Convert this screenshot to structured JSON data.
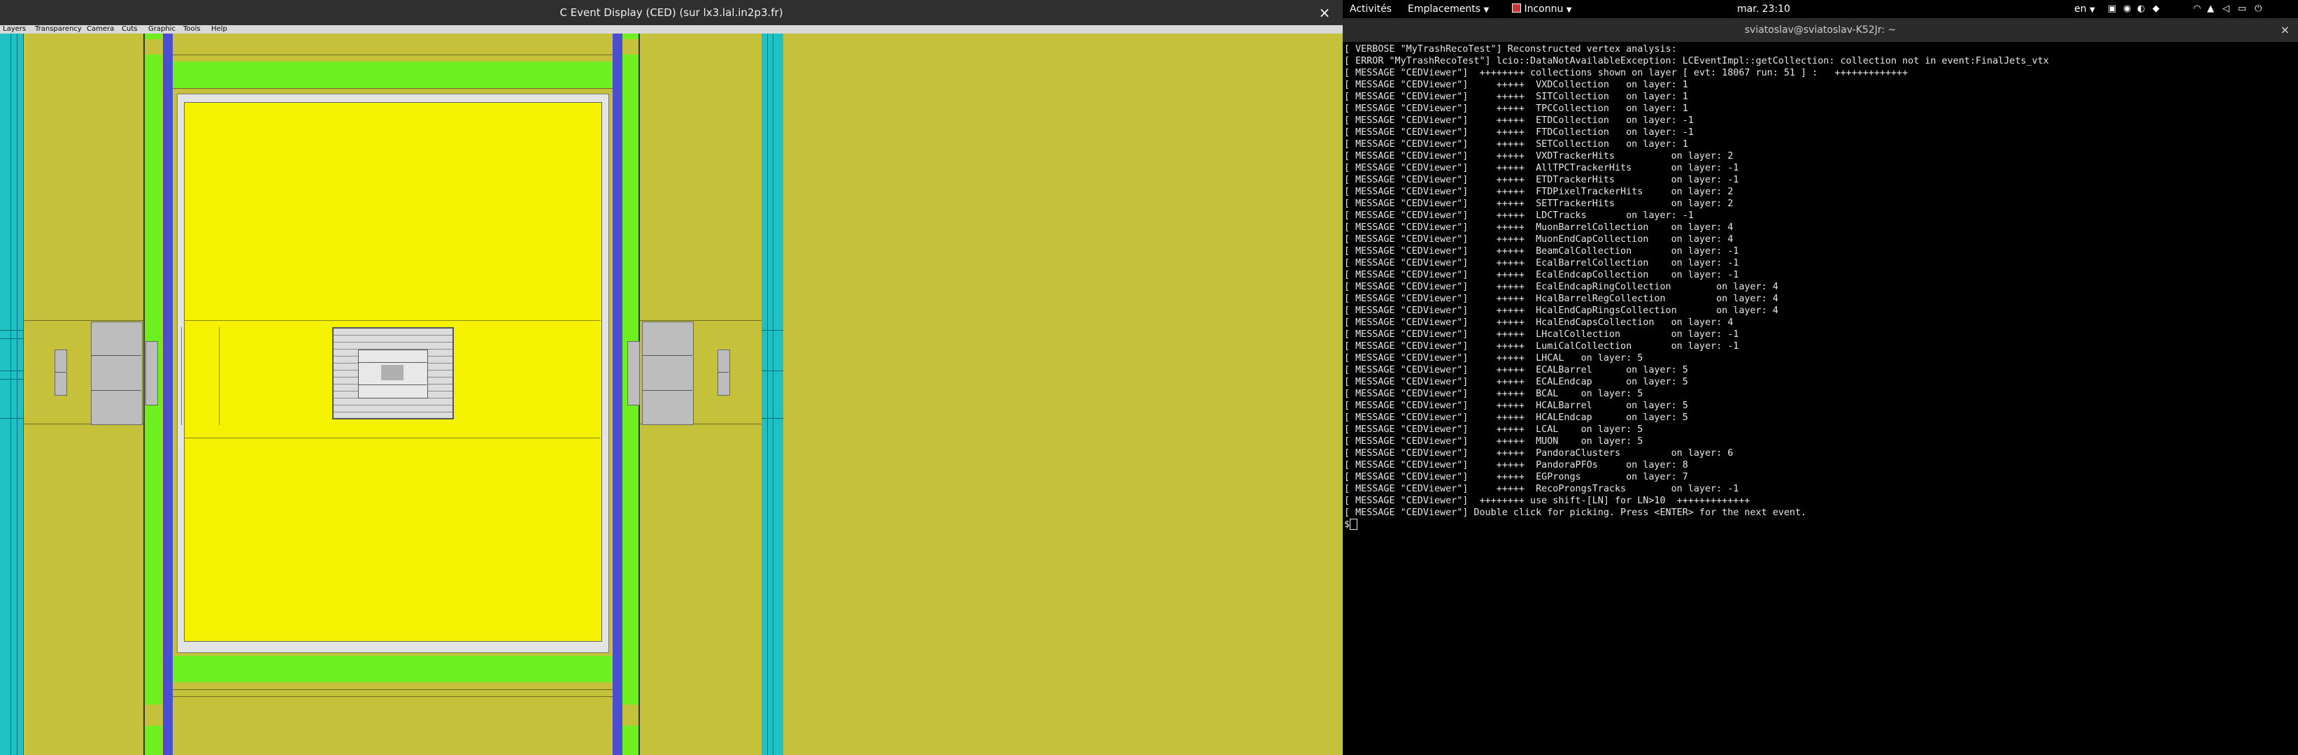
{
  "ced_window": {
    "title": "C Event Display (CED) (sur lx3.lal.in2p3.fr)",
    "close_glyph": "×",
    "menu": [
      "Layers",
      "Transparency",
      "Camera",
      "Cuts",
      "Graphic",
      "Tools",
      "Help"
    ]
  },
  "top_bar": {
    "activities": "Activités",
    "places": "Emplacements",
    "app": "Inconnu",
    "clock": "mar. 23:10",
    "language": "en",
    "status_icons": [
      "accessibility-icon",
      "app-indicator-icon",
      "wifi-icon",
      "volume-icon",
      "battery-icon"
    ]
  },
  "terminal": {
    "title": "sviatoslav@sviatoslav-K52Jr: ~",
    "close_glyph": "×",
    "lines": [
      "[ VERBOSE \"MyTrashRecoTest\"] Reconstructed vertex analysis:",
      "[ ERROR \"MyTrashRecoTest\"] lcio::DataNotAvailableException: LCEventImpl::getCollection: collection not in event:FinalJets_vtx",
      "[ MESSAGE \"CEDViewer\"]  ++++++++ collections shown on layer [ evt: 18067 run: 51 ] :   +++++++++++++",
      "[ MESSAGE \"CEDViewer\"]     +++++  VXDCollection   on layer: 1",
      "[ MESSAGE \"CEDViewer\"]     +++++  SITCollection   on layer: 1",
      "[ MESSAGE \"CEDViewer\"]     +++++  TPCCollection   on layer: 1",
      "[ MESSAGE \"CEDViewer\"]     +++++  ETDCollection   on layer: -1",
      "[ MESSAGE \"CEDViewer\"]     +++++  FTDCollection   on layer: -1",
      "[ MESSAGE \"CEDViewer\"]     +++++  SETCollection   on layer: 1",
      "[ MESSAGE \"CEDViewer\"]     +++++  VXDTrackerHits          on layer: 2",
      "[ MESSAGE \"CEDViewer\"]     +++++  AllTPCTrackerHits       on layer: -1",
      "[ MESSAGE \"CEDViewer\"]     +++++  ETDTrackerHits          on layer: -1",
      "[ MESSAGE \"CEDViewer\"]     +++++  FTDPixelTrackerHits     on layer: 2",
      "[ MESSAGE \"CEDViewer\"]     +++++  SETTrackerHits          on layer: 2",
      "[ MESSAGE \"CEDViewer\"]     +++++  LDCTracks       on layer: -1",
      "[ MESSAGE \"CEDViewer\"]     +++++  MuonBarrelCollection    on layer: 4",
      "[ MESSAGE \"CEDViewer\"]     +++++  MuonEndCapCollection    on layer: 4",
      "[ MESSAGE \"CEDViewer\"]     +++++  BeamCalCollection       on layer: -1",
      "[ MESSAGE \"CEDViewer\"]     +++++  EcalBarrelCollection    on layer: -1",
      "[ MESSAGE \"CEDViewer\"]     +++++  EcalEndcapCollection    on layer: -1",
      "[ MESSAGE \"CEDViewer\"]     +++++  EcalEndcapRingCollection        on layer: 4",
      "[ MESSAGE \"CEDViewer\"]     +++++  HcalBarrelRegCollection         on layer: 4",
      "[ MESSAGE \"CEDViewer\"]     +++++  HcalEndCapRingsCollection       on layer: 4",
      "[ MESSAGE \"CEDViewer\"]     +++++  HcalEndCapsCollection   on layer: 4",
      "[ MESSAGE \"CEDViewer\"]     +++++  LHcalCollection         on layer: -1",
      "[ MESSAGE \"CEDViewer\"]     +++++  LumiCalCollection       on layer: -1",
      "[ MESSAGE \"CEDViewer\"]     +++++  LHCAL   on layer: 5",
      "[ MESSAGE \"CEDViewer\"]     +++++  ECALBarrel      on layer: 5",
      "[ MESSAGE \"CEDViewer\"]     +++++  ECALEndcap      on layer: 5",
      "[ MESSAGE \"CEDViewer\"]     +++++  BCAL    on layer: 5",
      "[ MESSAGE \"CEDViewer\"]     +++++  HCALBarrel      on layer: 5",
      "[ MESSAGE \"CEDViewer\"]     +++++  HCALEndcap      on layer: 5",
      "[ MESSAGE \"CEDViewer\"]     +++++  LCAL    on layer: 5",
      "[ MESSAGE \"CEDViewer\"]     +++++  MUON    on layer: 5",
      "[ MESSAGE \"CEDViewer\"]     +++++  PandoraClusters         on layer: 6",
      "[ MESSAGE \"CEDViewer\"]     +++++  PandoraPFOs     on layer: 8",
      "[ MESSAGE \"CEDViewer\"]     +++++  EGProngs        on layer: 7",
      "[ MESSAGE \"CEDViewer\"]     +++++  RecoProngsTracks        on layer: -1",
      "[ MESSAGE \"CEDViewer\"]  ++++++++ use shift-[LN] for LN>10  +++++++++++++",
      "[ MESSAGE \"CEDViewer\"] Double click for picking. Press <ENTER> for the next event."
    ],
    "prompt": "$"
  }
}
